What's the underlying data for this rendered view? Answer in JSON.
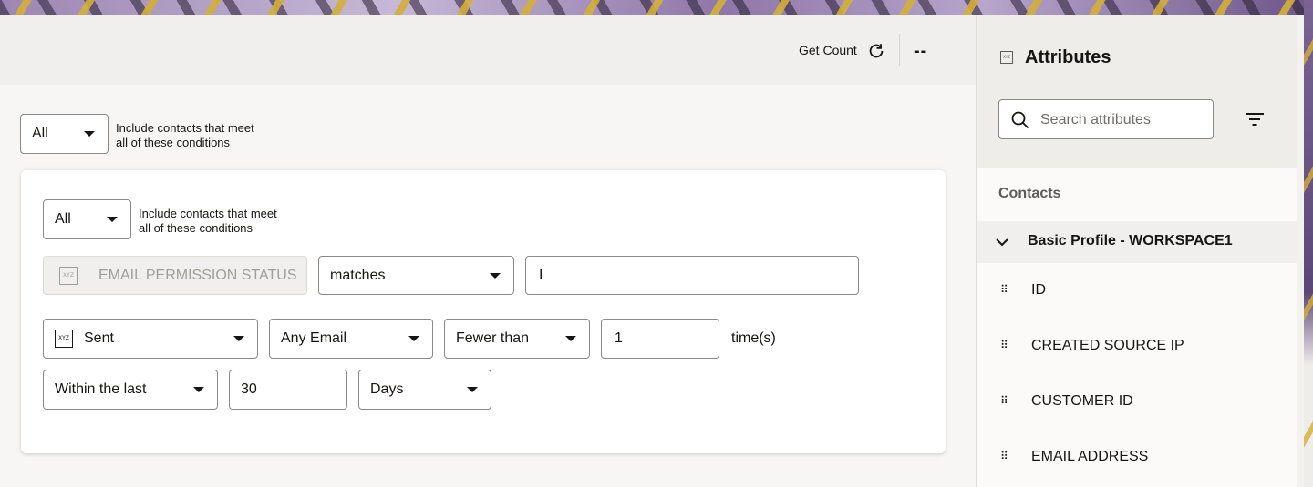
{
  "header": {
    "get_count_label": "Get Count",
    "count_value": "--"
  },
  "outer_group": {
    "match_select": "All",
    "description_line1": "Include contacts that meet",
    "description_line2": "all of these conditions"
  },
  "condition_card": {
    "match_select": "All",
    "description_line1": "Include contacts that meet",
    "description_line2": "all of these conditions",
    "row1": {
      "attribute": "EMAIL PERMISSION STATUS",
      "operator": "matches",
      "value": "I"
    },
    "row2": {
      "activity": "Sent",
      "email": "Any Email",
      "comparison": "Fewer than",
      "count": "1",
      "unit_label": "time(s)"
    },
    "row3": {
      "time_range": "Within the last",
      "amount": "30",
      "period": "Days"
    }
  },
  "sidebar": {
    "title": "Attributes",
    "search_placeholder": "Search attributes",
    "section_label": "Contacts",
    "group_label": "Basic Profile - WORKSPACE1",
    "items": [
      "ID",
      "CREATED SOURCE IP",
      "CUSTOMER ID",
      "EMAIL ADDRESS"
    ]
  },
  "icons": {
    "xyz_glyph": "XYZ"
  }
}
